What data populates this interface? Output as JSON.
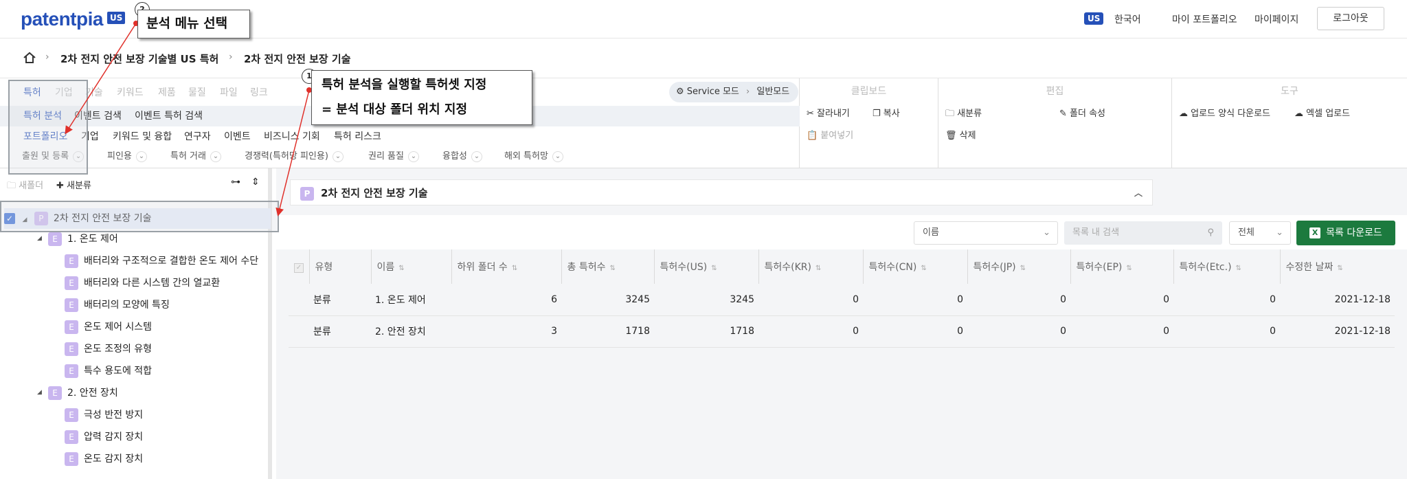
{
  "header": {
    "logo": "patentpia",
    "logo_badge": "US",
    "lang_badge": "US",
    "lang": "한국어",
    "my_portfolio": "마이 포트폴리오",
    "mypage": "마이페이지",
    "logout": "로그아웃"
  },
  "breadcrumb": {
    "home_icon": "home-icon",
    "items": [
      "2차 전지 안전 보장 기술별 US 특허",
      "2차 전지 안전 보장 기술"
    ]
  },
  "menu": {
    "level1": [
      "특허",
      "기업",
      "기술",
      "키워드",
      "제품",
      "물질",
      "파일",
      "링크"
    ],
    "level2": [
      "특허 분석",
      "이벤트 검색",
      "이벤트 특허 검색"
    ],
    "level3": [
      "포트폴리오",
      "기업",
      "키워드 및 융합",
      "연구자",
      "이벤트",
      "비즈니스 기회",
      "특허 리스크"
    ],
    "level4": [
      "출원 및 등록",
      "피인용",
      "특허 거래",
      "경쟁력(특허당 피인용)",
      "권리 품질",
      "융합성",
      "해외 특허망"
    ],
    "service_mode": "Service 모드",
    "normal_mode": "일반모드"
  },
  "toolbar": {
    "clipboard_title": "클립보드",
    "cut": "잘라내기",
    "copy": "복사",
    "paste": "붙여넣기",
    "edit_title": "편집",
    "new_category": "새분류",
    "folder_props": "폴더 속성",
    "delete": "삭제",
    "tools_title": "도구",
    "upload_form_download": "업로드 양식 다운로드",
    "excel_upload": "엑셀 업로드"
  },
  "tree": {
    "new_folder": "새폴더",
    "new_category": "새분류",
    "root": "2차 전지 안전 보장 기술",
    "root_icon_letter": "P",
    "cat_icon_letter": "E",
    "groups": [
      {
        "label": "1. 온도 제어",
        "children": [
          "배터리와 구조적으로 결합한 온도 제어 수단",
          "배터리와 다른 시스템 간의 열교환",
          "배터리의 모양에 특징",
          "온도 제어 시스템",
          "온도 조정의 유형",
          "특수 용도에 적합"
        ]
      },
      {
        "label": "2. 안전 장치",
        "children": [
          "극성 반전 방지",
          "압력 감지 장치",
          "온도 감지 장치"
        ]
      }
    ]
  },
  "main": {
    "folder_title": "2차 전지 안전 보장 기술",
    "folder_icon_letter": "P",
    "sort_select": "이름",
    "search_placeholder": "목록 내 검색",
    "scope_select": "전체",
    "download_button": "목록 다운로드",
    "columns": [
      "유형",
      "이름",
      "하위 폴더 수",
      "총 특허수",
      "특허수(US)",
      "특허수(KR)",
      "특허수(CN)",
      "특허수(JP)",
      "특허수(EP)",
      "특허수(Etc.)",
      "수정한 날짜"
    ],
    "rows": [
      [
        "분류",
        "1. 온도 제어",
        "6",
        "3245",
        "3245",
        "0",
        "0",
        "0",
        "0",
        "0",
        "2021-12-18"
      ],
      [
        "분류",
        "2. 안전 장치",
        "3",
        "1718",
        "1718",
        "0",
        "0",
        "0",
        "0",
        "0",
        "2021-12-18"
      ]
    ]
  },
  "annotations": {
    "badge1": "1",
    "callout1_line1": "특허 분석을 실행할 특허셋 지정",
    "callout1_line2": "= 분석 대상 폴더 위치 지정",
    "badge2": "2",
    "callout2": "분석 메뉴 선택"
  },
  "colors": {
    "brand": "#2550b8",
    "excel_green": "#1c7a3e",
    "category_icon": "#c9b6ef",
    "annotation_arrow": "#e0302a"
  }
}
